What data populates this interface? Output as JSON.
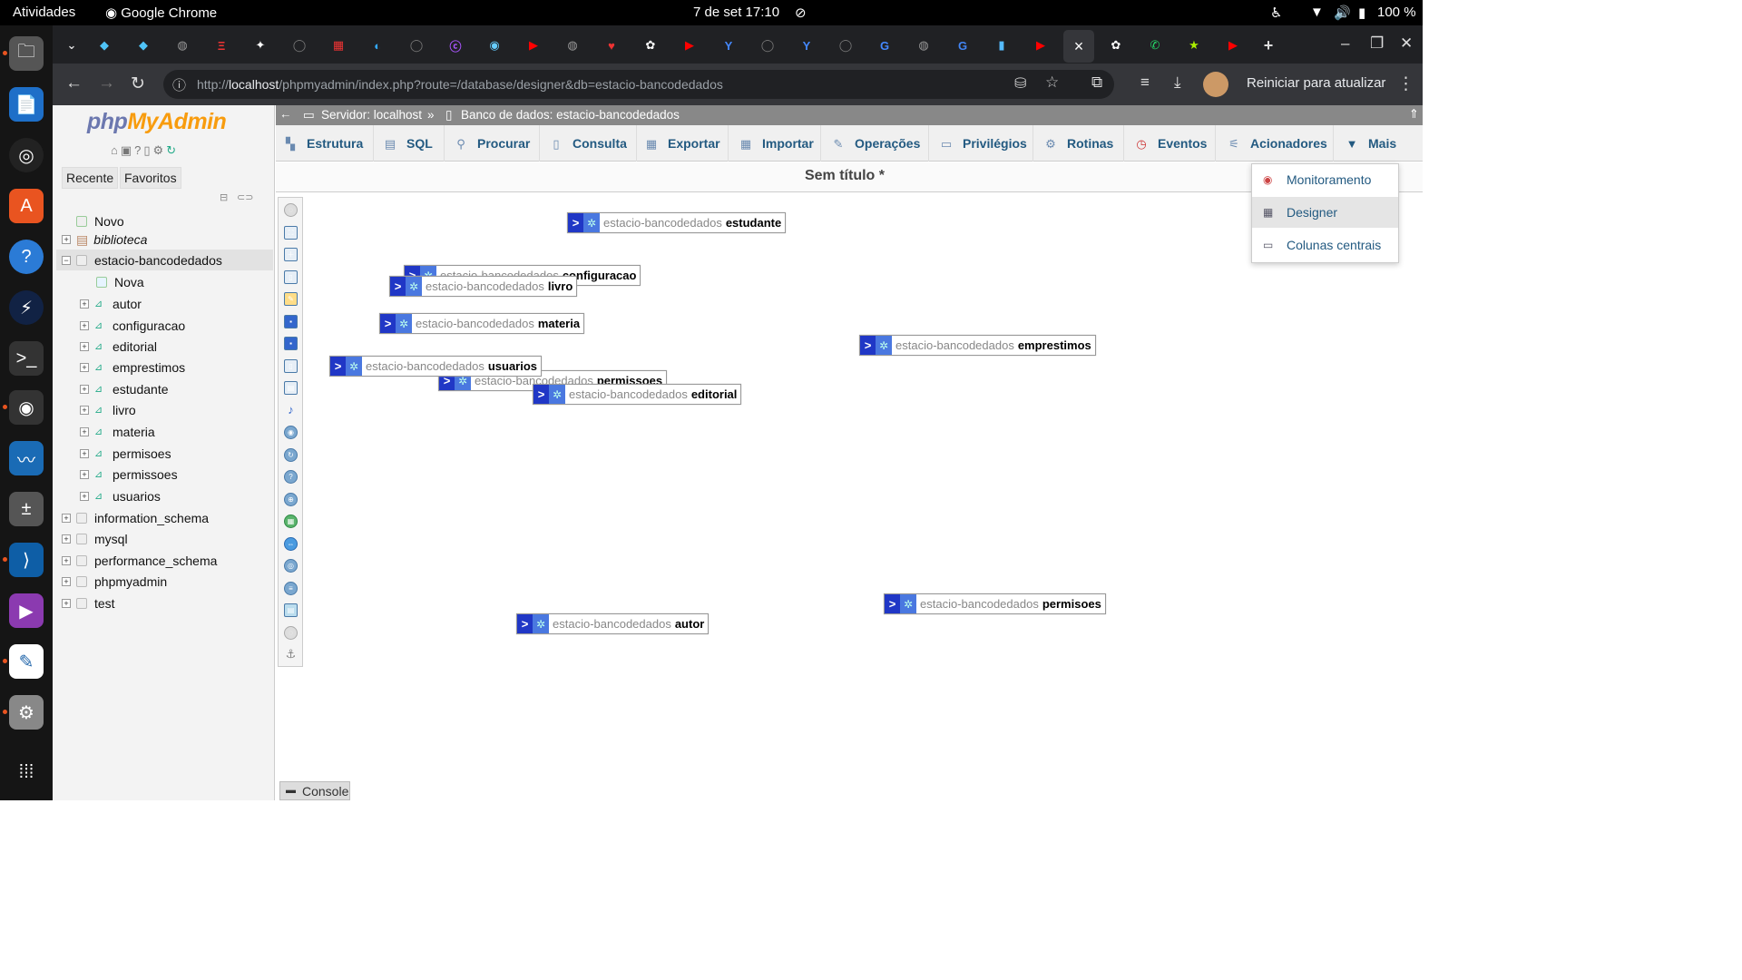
{
  "os": {
    "activities": "Atividades",
    "app": "Google Chrome",
    "clock": "7 de set  17:10",
    "battery": "100 %"
  },
  "chrome": {
    "url_prefix": "http://",
    "url_host": "localhost",
    "url_path": "/phpmyadmin/index.php?route=/database/designer&db=estacio-bancodedados",
    "update_label": "Reiniciar para atualizar"
  },
  "pma": {
    "logo_a": "php",
    "logo_b": "MyAdmin",
    "recent": "Recente",
    "favorites": "Favoritos",
    "tree": {
      "new": "Novo",
      "biblioteca": "biblioteca",
      "db": "estacio-bancodedados",
      "nova": "Nova",
      "tables": [
        "autor",
        "configuracao",
        "editorial",
        "emprestimos",
        "estudante",
        "livro",
        "materia",
        "permisoes",
        "permissoes",
        "usuarios"
      ],
      "other_dbs": [
        "information_schema",
        "mysql",
        "performance_schema",
        "phpmyadmin",
        "test"
      ]
    },
    "breadcrumb": {
      "server": "Servidor: localhost",
      "sep": "»",
      "db": "Banco de dados: estacio-bancodedados"
    },
    "tabs": [
      "Estrutura",
      "SQL",
      "Procurar",
      "Consulta",
      "Exportar",
      "Importar",
      "Operações",
      "Privilégios",
      "Rotinas",
      "Eventos",
      "Acionadores",
      "Mais"
    ],
    "designer_title": "Sem título *",
    "dropdown": [
      "Monitoramento",
      "Designer",
      "Colunas centrais"
    ],
    "console": "Console"
  },
  "designer": {
    "prefix": "estacio-bancodedados",
    "toggle": ">",
    "tables": [
      "estudante",
      "configuracao",
      "livro",
      "materia",
      "emprestimos",
      "usuarios",
      "permissoes",
      "editorial",
      "permisoes",
      "autor"
    ]
  },
  "colors": {
    "accent": "#235a81",
    "toggle": "#2037c6"
  }
}
